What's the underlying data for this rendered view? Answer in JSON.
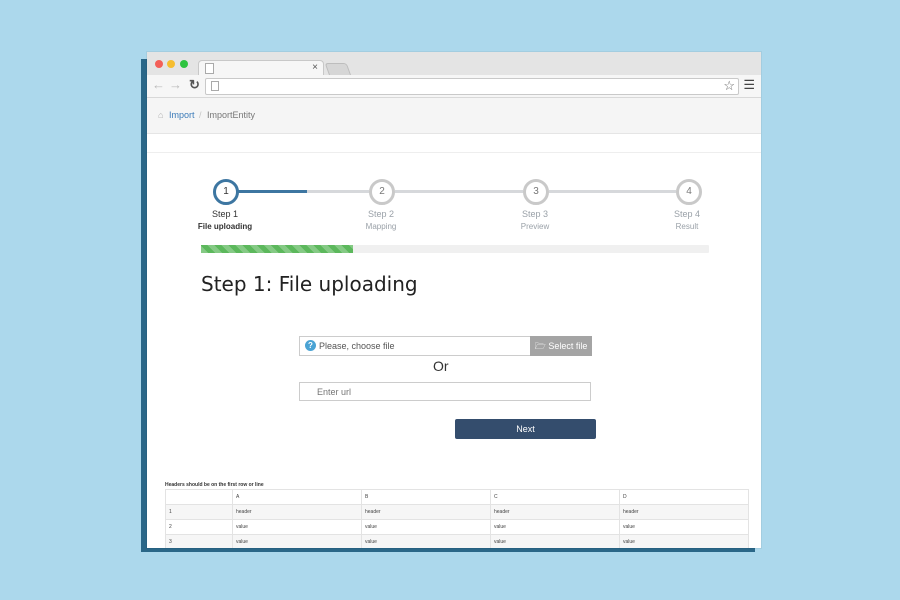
{
  "browser": {
    "tab_close": "×",
    "back_icon": "arrow-left-icon",
    "forward_icon": "arrow-right-icon",
    "reload_icon": "reload-icon",
    "bookmark_icon": "star-icon",
    "menu_icon": "hamburger-icon"
  },
  "breadcrumb": {
    "items": [
      "Import",
      "ImportEntity"
    ],
    "separator": "/"
  },
  "stepper": {
    "steps": [
      {
        "number": "1",
        "title": "Step 1",
        "subtitle": "File uploading",
        "active": true
      },
      {
        "number": "2",
        "title": "Step 2",
        "subtitle": "Mapping",
        "active": false
      },
      {
        "number": "3",
        "title": "Step 3",
        "subtitle": "Preview",
        "active": false
      },
      {
        "number": "4",
        "title": "Step 4",
        "subtitle": "Result",
        "active": false
      }
    ],
    "progress_fraction": 0.3
  },
  "colors": {
    "accent": "#3d76a1",
    "progress": "#5cb85c",
    "next_button": "#344d6d",
    "background": "#acd8ec"
  },
  "main": {
    "heading": "Step 1: File uploading",
    "file_placeholder": "Please, choose file",
    "select_file_label": "Select file",
    "or_label": "Or",
    "url_placeholder": "Enter url",
    "next_label": "Next"
  },
  "sample_table": {
    "caption": "Headers should be on the first row or line",
    "columns": [
      "",
      "A",
      "B",
      "C",
      "D"
    ],
    "rows": [
      [
        "1",
        "header",
        "header",
        "header",
        "header"
      ],
      [
        "2",
        "value",
        "value",
        "value",
        "value"
      ],
      [
        "3",
        "value",
        "value",
        "value",
        "value"
      ]
    ]
  }
}
